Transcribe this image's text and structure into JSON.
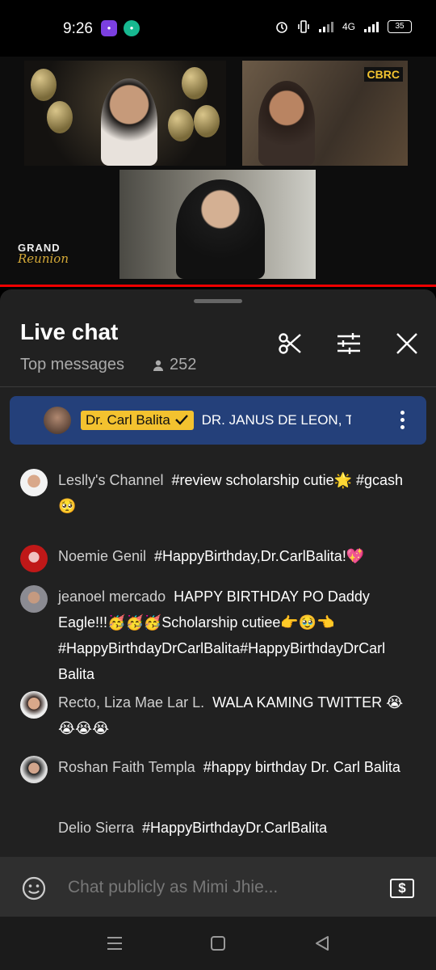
{
  "status_bar": {
    "time": "9:26",
    "network": "4G",
    "battery": "35"
  },
  "video": {
    "channel_logo": "CBRC",
    "overlay_title_1": "GRAND",
    "overlay_title_2": "Reunion",
    "progress_fraction": 1.0
  },
  "chat": {
    "title": "Live chat",
    "filter": "Top messages",
    "viewer_count": "252",
    "icons": [
      "scissors-icon",
      "tune-icon",
      "close-icon"
    ]
  },
  "pinned": {
    "author": "Dr. Carl Balita",
    "message": "DR. JANUS DE LEON, T"
  },
  "messages": [
    {
      "author": "Leslly's Channel",
      "text": "#review scholarship cutie🌟 #gcash 🥺"
    },
    {
      "author": "Noemie Genil",
      "text": "#HappyBirthday,Dr.CarlBalita!💖"
    },
    {
      "author": "jeanoel mercado",
      "text": "HAPPY BIRTHDAY PO Daddy Eagle!!!🥳🥳🥳Scholarship cutiee👉🥹👈 #HappyBirthdayDrCarlBalita#HappyBirthdayDrCarl Balita"
    },
    {
      "author": "Recto, Liza Mae Lar L.",
      "text": "WALA KAMING TWITTER 😭😭😭😭"
    },
    {
      "author": "Roshan Faith Templa",
      "text": "#happy birthday Dr. Carl Balita"
    },
    {
      "author": "Delio Sierra",
      "text": "#HappyBirthdayDr.CarlBalita"
    }
  ],
  "input": {
    "placeholder": "Chat publicly as Mimi Jhie...",
    "super_chat_icon": "$"
  },
  "colors": {
    "panel_bg": "#212121",
    "pinned_bg": "#24407a",
    "badge_bg": "#f3c22f",
    "progress": "#ee0000"
  }
}
